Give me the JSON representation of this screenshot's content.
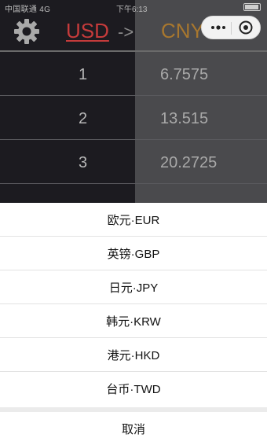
{
  "status_bar": {
    "carrier": "中国联通 4G",
    "time": "下午6:13"
  },
  "header": {
    "from_currency": "USD",
    "arrow": "->",
    "to_currency": "CNY"
  },
  "capsule": {
    "more_icon": "more-dots-icon",
    "close_icon": "target-close-icon"
  },
  "rows": [
    {
      "amount": "1",
      "converted": "6.7575"
    },
    {
      "amount": "2",
      "converted": "13.515"
    },
    {
      "amount": "3",
      "converted": "20.2725"
    }
  ],
  "action_sheet": {
    "options": [
      {
        "label": "欧元·EUR"
      },
      {
        "label": "英镑·GBP"
      },
      {
        "label": "日元·JPY"
      },
      {
        "label": "韩元·KRW"
      },
      {
        "label": "港元·HKD"
      },
      {
        "label": "台币·TWD"
      }
    ],
    "cancel": "取消"
  },
  "colors": {
    "from_currency": "#c53b3b",
    "to_currency": "#a8772e"
  }
}
